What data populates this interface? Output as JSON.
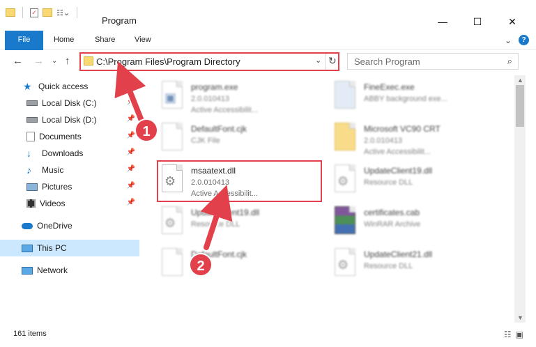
{
  "window": {
    "title": "Program",
    "minimize": "—",
    "maximize": "☐",
    "close": "✕"
  },
  "ribbon": {
    "tabs": [
      "File",
      "Home",
      "Share",
      "View"
    ],
    "collapse": "⌄",
    "help": "?"
  },
  "address": {
    "path": "C:\\Program Files\\Program Directory",
    "chevron": "⌄",
    "refresh": "↻"
  },
  "search": {
    "placeholder": "Search Program"
  },
  "nav": {
    "back": "←",
    "forward": "→",
    "recent": "⌄",
    "up": "↑",
    "items": [
      {
        "label": "Quick access",
        "icon": "star-icon"
      },
      {
        "label": "Local Disk (C:)",
        "icon": "drive-icon"
      },
      {
        "label": "Local Disk (D:)",
        "icon": "drive-icon"
      },
      {
        "label": "Documents",
        "icon": "documents-icon"
      },
      {
        "label": "Downloads",
        "icon": "downloads-icon"
      },
      {
        "label": "Music",
        "icon": "music-icon"
      },
      {
        "label": "Pictures",
        "icon": "pictures-icon"
      },
      {
        "label": "Videos",
        "icon": "videos-icon"
      },
      {
        "label": "OneDrive",
        "icon": "cloud-icon"
      },
      {
        "label": "This PC",
        "icon": "computer-icon"
      },
      {
        "label": "Network",
        "icon": "network-icon"
      }
    ]
  },
  "files": {
    "left": [
      {
        "name": "program.exe",
        "l2": "2.0.010413",
        "l3": "Active Accessibilit..."
      },
      {
        "name": "DefaultFont.cjk",
        "l2": "CJK File",
        "l3": ""
      },
      {
        "name": "msaatext.dll",
        "l2": "2.0.010413",
        "l3": "Active Accessibilit..."
      },
      {
        "name": "UpdateClient19.dll",
        "l2": "Resource DLL",
        "l3": ""
      },
      {
        "name": "DefaultFont.cjk",
        "l2": "",
        "l3": ""
      }
    ],
    "right": [
      {
        "name": "FineExec.exe",
        "l2": "ABBY background exe...",
        "l3": ""
      },
      {
        "name": "Microsoft VC90 CRT",
        "l2": "2.0.010413",
        "l3": "Active Accessibilit..."
      },
      {
        "name": "UpdateClient19.dll",
        "l2": "Resource DLL",
        "l3": ""
      },
      {
        "name": "certificates.cab",
        "l2": "WinRAR Archive",
        "l3": ""
      },
      {
        "name": "UpdateClient21.dll",
        "l2": "Resource DLL",
        "l3": ""
      }
    ]
  },
  "callouts": [
    "1",
    "2"
  ],
  "status": {
    "count": "161 items"
  },
  "colors": {
    "accent": "#1979ca",
    "highlight": "#e2404a",
    "selected": "#cce8ff"
  }
}
